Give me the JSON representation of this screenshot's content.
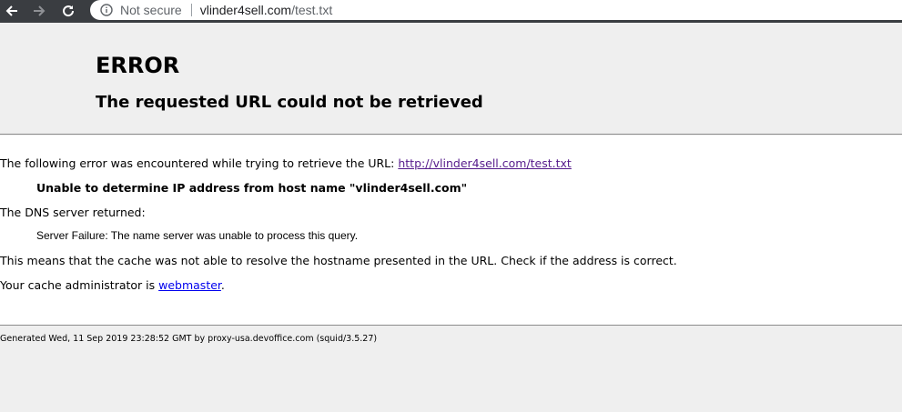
{
  "browser": {
    "security_label": "Not secure",
    "url_host": "vlinder4sell.com",
    "url_path": "/test.txt"
  },
  "header": {
    "title": "ERROR",
    "subtitle": "The requested URL could not be retrieved"
  },
  "body": {
    "intro": "The following error was encountered while trying to retrieve the URL: ",
    "url_link": "http://vlinder4sell.com/test.txt",
    "error_detail": "Unable to determine IP address from host name \"vlinder4sell.com\"",
    "dns_label": "The DNS server returned:",
    "dns_message": "Server Failure: The name server was unable to process this query.",
    "explanation": "This means that the cache was not able to resolve the hostname presented in the URL. Check if the address is correct.",
    "admin_prefix": "Your cache administrator is ",
    "admin_link": "webmaster",
    "admin_suffix": "."
  },
  "footer": {
    "generated": "Generated Wed, 11 Sep 2019 23:28:52 GMT by proxy-usa.devoffice.com (squid/3.5.27)"
  },
  "colors": {
    "toolbar": "#3a3d41",
    "visited_link": "#551a8b",
    "link": "#0000ee",
    "header_bg": "#efefef"
  },
  "icons": {
    "back": "back-arrow-icon",
    "forward": "forward-arrow-icon",
    "reload": "reload-icon",
    "info": "info-icon"
  }
}
